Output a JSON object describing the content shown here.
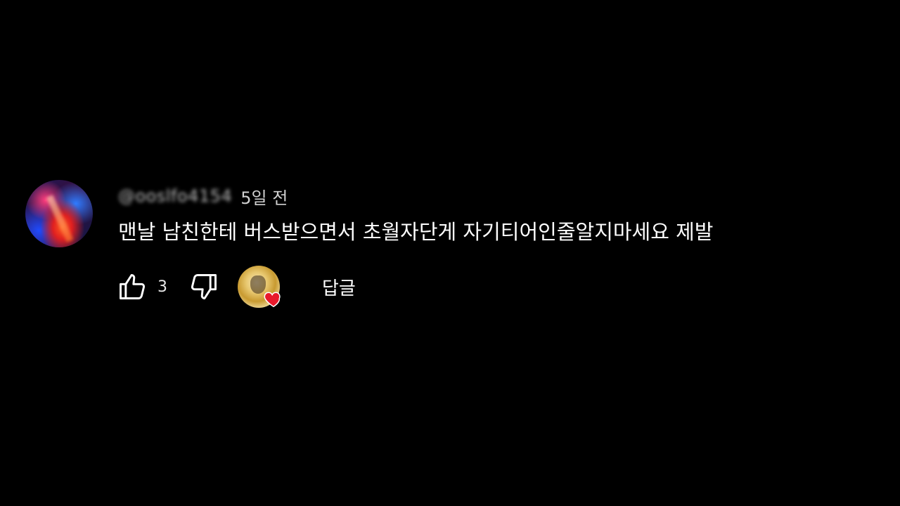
{
  "comment": {
    "author": "@ooslfo4154",
    "timestamp": "5일 전",
    "text": "맨날 남친한테 버스받으면서 초월자단게 자기티어인줄알지마세요 제발",
    "likes": "3",
    "reply_label": "답글",
    "icons": {
      "like": "thumbs-up-icon",
      "dislike": "thumbs-down-icon",
      "creator_heart": "heart-icon"
    },
    "heart_color": "#e8192c"
  }
}
